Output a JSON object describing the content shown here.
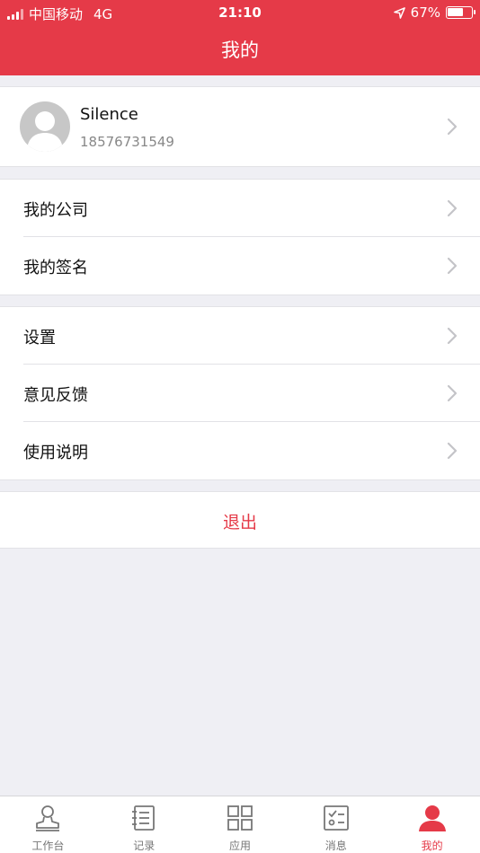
{
  "status_bar": {
    "carrier": "中国移动",
    "network": "4G",
    "time": "21:10",
    "battery": "67%",
    "battery_level": 0.67
  },
  "header": {
    "title": "我的"
  },
  "profile": {
    "name": "Silence",
    "phone": "18576731549"
  },
  "menu": {
    "company": "我的公司",
    "signature": "我的签名",
    "settings": "设置",
    "feedback": "意见反馈",
    "instructions": "使用说明"
  },
  "logout_label": "退出",
  "tabs": [
    {
      "label": "工作台",
      "icon": "workbench-icon"
    },
    {
      "label": "记录",
      "icon": "record-icon"
    },
    {
      "label": "应用",
      "icon": "apps-icon"
    },
    {
      "label": "消息",
      "icon": "message-icon"
    },
    {
      "label": "我的",
      "icon": "profile-icon",
      "active": true
    }
  ],
  "colors": {
    "accent": "#e53a48",
    "background": "#efeff4",
    "chevron": "#c4c4c8"
  }
}
